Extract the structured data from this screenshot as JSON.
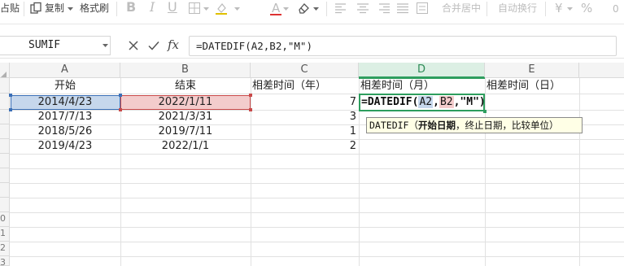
{
  "toolbar": {
    "paste_label": "占贴",
    "copy_label": "复制",
    "format_painter_label": "格式刷",
    "bold_label": "B",
    "italic_label": "I",
    "underline_label": "U",
    "font_color_label": "A",
    "merge_center_label": "合并居中",
    "wrap_text_label": "自动换行",
    "currency_label": "¥",
    "percent_label": "%"
  },
  "formula_bar": {
    "name_box": "SUMIF",
    "fx_label": "fx",
    "formula": "=DATEDIF(A2,B2,\"M\")"
  },
  "columns": [
    "A",
    "B",
    "C",
    "D",
    "E"
  ],
  "selected_column": "D",
  "row_numbers": [
    "0",
    "1",
    "2",
    "3"
  ],
  "headers": {
    "a": "开始",
    "b": "结束",
    "c": "相差时间（年）",
    "d": "相差时间（月）",
    "e": "相差时间（日）"
  },
  "rows": [
    {
      "a": "2014/4/23",
      "b": "2022/1/11",
      "c": "7"
    },
    {
      "a": "2017/7/13",
      "b": "2021/3/31",
      "c": "3"
    },
    {
      "a": "2018/5/26",
      "b": "2019/7/11",
      "c": "1"
    },
    {
      "a": "2019/4/23",
      "b": "2022/1/1",
      "c": "2"
    }
  ],
  "editing": {
    "prefix": "=DATEDIF(",
    "ref1": "A2",
    "sep1": ",",
    "ref2": "B2",
    "suffix": ",\"M\")"
  },
  "tooltip": {
    "func": "DATEDIF",
    "open": "（",
    "arg1": "开始日期",
    "rest": "，终止日期，比较单位）"
  },
  "colors": {
    "selection_green": "#2e9e5e",
    "ref_blue": "#c6d7ec",
    "ref_red": "#f3cccc",
    "tooltip_bg": "#ffffe6"
  }
}
